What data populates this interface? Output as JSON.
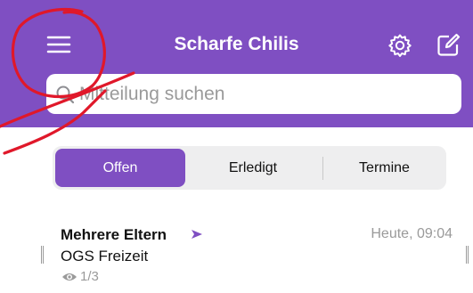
{
  "header": {
    "title": "Scharfe Chilis",
    "icons": {
      "menu": "hamburger-menu-icon",
      "settings": "gear-icon",
      "compose": "compose-icon"
    }
  },
  "search": {
    "placeholder": "Mitteilung suchen",
    "icon": "search-icon"
  },
  "tabs": [
    {
      "label": "Offen",
      "active": true
    },
    {
      "label": "Erledigt",
      "active": false
    },
    {
      "label": "Termine",
      "active": false
    }
  ],
  "messages": [
    {
      "sender": "Mehrere Eltern",
      "subject": "OGS Freizeit",
      "time": "Heute, 09:04",
      "read_count": "1/3"
    }
  ],
  "colors": {
    "accent": "#7f4fc2",
    "annotation": "#e0182a"
  }
}
